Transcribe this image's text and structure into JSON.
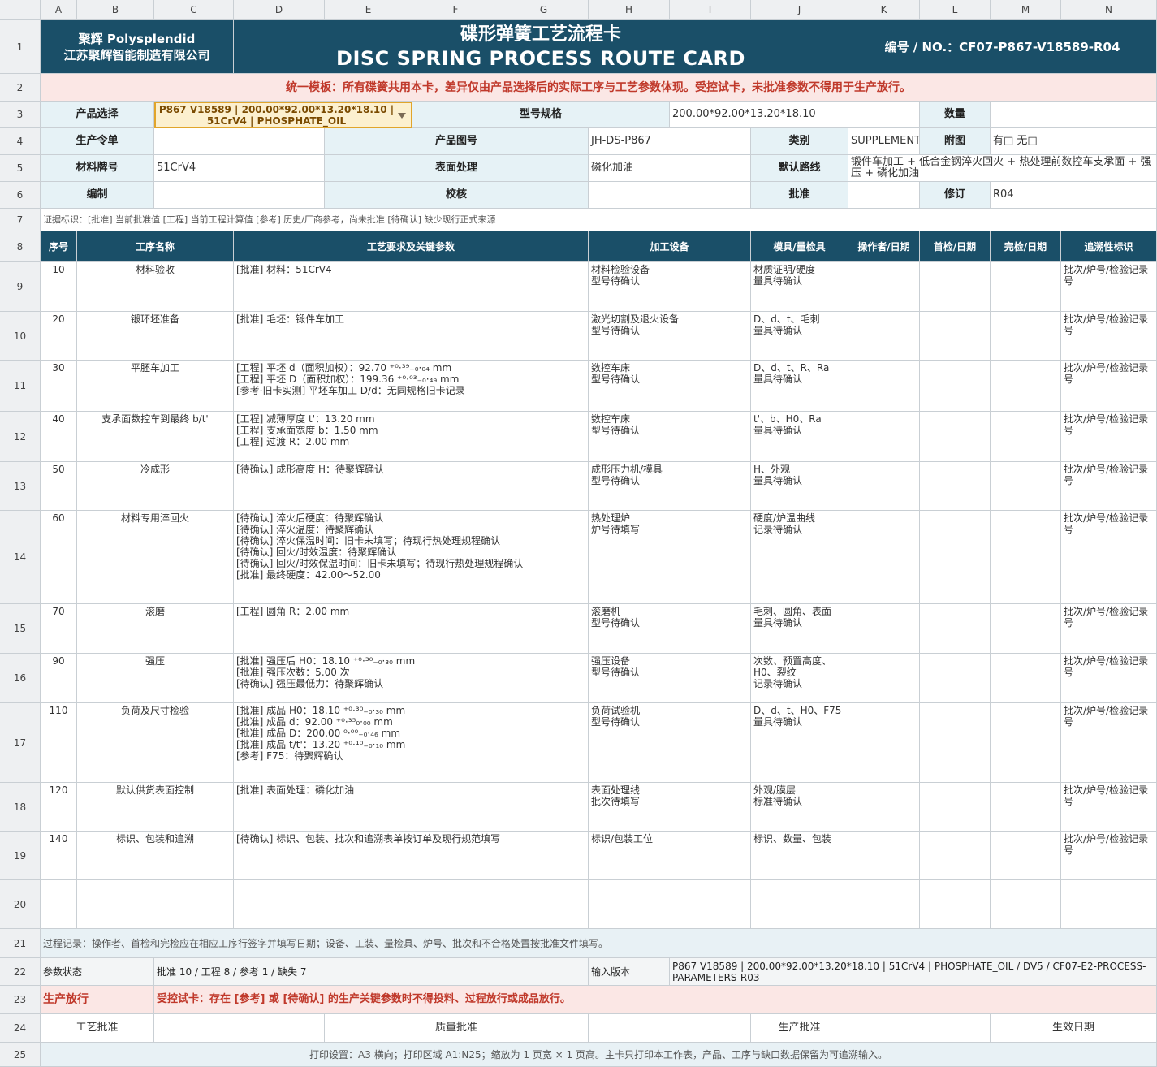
{
  "columns": [
    "A",
    "B",
    "C",
    "D",
    "E",
    "F",
    "G",
    "H",
    "I",
    "J",
    "K",
    "L",
    "M",
    "N"
  ],
  "rows": [
    "1",
    "2",
    "3",
    "4",
    "5",
    "6",
    "7",
    "8",
    "9",
    "10",
    "11",
    "12",
    "13",
    "14",
    "15",
    "16",
    "17",
    "18",
    "19",
    "20",
    "21",
    "22",
    "23",
    "24",
    "25"
  ],
  "header": {
    "company_en": "聚辉 Polysplendid",
    "company_cn": "江苏聚辉智能制造有限公司",
    "title_cn": "碟形弹簧工艺流程卡",
    "title_en": "DISC SPRING PROCESS ROUTE CARD",
    "number": "编号 / NO.：CF07-P867-V18589-R04"
  },
  "notice": "统一模板：所有碟簧共用本卡，差异仅由产品选择后的实际工序与工艺参数体现。受控试卡，未批准参数不得用于生产放行。",
  "info": {
    "product_select_label": "产品选择",
    "product_select_value": "P867 V18589 | 200.00*92.00*13.20*18.10 | 51CrV4 | PHOSPHATE_OIL",
    "model_spec_label": "型号规格",
    "model_spec_value": "200.00*92.00*13.20*18.10",
    "quantity_label": "数量",
    "quantity_value": "",
    "order_label": "生产令单",
    "order_value": "",
    "drawing_label": "产品图号",
    "drawing_value": "JH-DS-P867",
    "category_label": "类别",
    "category_value": "SUPPLEMENTARY",
    "attachment_label": "附图",
    "attachment_value": "有□  无□",
    "material_label": "材料牌号",
    "material_value": "51CrV4",
    "surface_label": "表面处理",
    "surface_value": "磷化加油",
    "route_label": "默认路线",
    "route_value": "锻件车加工 + 低合金钢淬火回火 + 热处理前数控车支承面 + 强压 + 磷化加油",
    "compile_label": "编制",
    "compile_value": "",
    "check_label": "校核",
    "check_value": "",
    "approve_label": "批准",
    "approve_value": "",
    "revision_label": "修订",
    "revision_value": "R04"
  },
  "evidence_note": "证据标识：[批准] 当前批准值   [工程] 当前工程计算值   [参考] 历史/厂商参考，尚未批准   [待确认] 缺少现行正式来源",
  "table_headers": {
    "seq": "序号",
    "name": "工序名称",
    "req": "工艺要求及关键参数",
    "equip": "加工设备",
    "tool": "模具/量检具",
    "operator": "操作者/日期",
    "first": "首检/日期",
    "final": "完检/日期",
    "trace": "追溯性标识"
  },
  "steps": [
    {
      "seq": "10",
      "name": "材料验收",
      "req": "[批准] 材料：51CrV4",
      "equip": "材料检验设备\n型号待确认",
      "tool": "材质证明/硬度\n量具待确认",
      "trace": "批次/炉号/检验记录号"
    },
    {
      "seq": "20",
      "name": "锻环坯准备",
      "req": "[批准] 毛坯：锻件车加工",
      "equip": "激光切割及退火设备\n型号待确认",
      "tool": "D、d、t、毛刺\n量具待确认",
      "trace": "批次/炉号/检验记录号"
    },
    {
      "seq": "30",
      "name": "平胚车加工",
      "req": "[工程] 平坯 d（面积加权）：92.70 ⁺⁰·³⁹₋₀·₀₄ mm\n[工程] 平坯 D（面积加权）：199.36 ⁺⁰·⁰³₋₀·₄₉ mm\n[参考·旧卡实测] 平坯车加工 D/d：无同规格旧卡记录",
      "equip": "数控车床\n型号待确认",
      "tool": "D、d、t、R、Ra\n量具待确认",
      "trace": "批次/炉号/检验记录号"
    },
    {
      "seq": "40",
      "name": "支承面数控车到最终 b/t'",
      "req": "[工程] 减薄厚度 t'：13.20 mm\n[工程] 支承面宽度 b：1.50 mm\n[工程] 过渡 R：2.00 mm",
      "equip": "数控车床\n型号待确认",
      "tool": "t'、b、H0、Ra\n量具待确认",
      "trace": "批次/炉号/检验记录号"
    },
    {
      "seq": "50",
      "name": "冷成形",
      "req": "[待确认] 成形高度 H：待聚辉确认",
      "equip": "成形压力机/模具\n型号待确认",
      "tool": "H、外观\n量具待确认",
      "trace": "批次/炉号/检验记录号"
    },
    {
      "seq": "60",
      "name": "材料专用淬回火",
      "req": "[待确认] 淬火后硬度：待聚辉确认\n[待确认] 淬火温度：待聚辉确认\n[待确认] 淬火保温时间：旧卡未填写；待现行热处理规程确认\n[待确认] 回火/时效温度：待聚辉确认\n[待确认] 回火/时效保温时间：旧卡未填写；待现行热处理规程确认\n[批准] 最终硬度：42.00～52.00",
      "equip": "热处理炉\n炉号待填写",
      "tool": "硬度/炉温曲线\n记录待确认",
      "trace": "批次/炉号/检验记录号"
    },
    {
      "seq": "70",
      "name": "滚磨",
      "req": "[工程] 圆角 R：2.00 mm",
      "equip": "滚磨机\n型号待确认",
      "tool": "毛刺、圆角、表面\n量具待确认",
      "trace": "批次/炉号/检验记录号"
    },
    {
      "seq": "90",
      "name": "强压",
      "req": "[批准] 强压后 H0：18.10 ⁺⁰·³⁰₋₀·₃₀ mm\n[批准] 强压次数：5.00 次\n[待确认] 强压最低力：待聚辉确认",
      "equip": "强压设备\n型号待确认",
      "tool": "次数、预置高度、H0、裂纹\n记录待确认",
      "trace": "批次/炉号/检验记录号"
    },
    {
      "seq": "110",
      "name": "负荷及尺寸检验",
      "req": "[批准] 成品 H0：18.10 ⁺⁰·³⁰₋₀·₃₀ mm\n[批准] 成品 d：92.00 ⁺⁰·³⁵₀·₀₀ mm\n[批准] 成品 D：200.00 ⁰·⁰⁰₋₀·₄₆ mm\n[批准] 成品 t/t'：13.20 ⁺⁰·¹⁰₋₀·₁₀ mm\n[参考] F75：待聚辉确认",
      "equip": "负荷试验机\n型号待确认",
      "tool": "D、d、t、H0、F75\n量具待确认",
      "trace": "批次/炉号/检验记录号"
    },
    {
      "seq": "120",
      "name": "默认供货表面控制",
      "req": "[批准] 表面处理：磷化加油",
      "equip": "表面处理线\n批次待填写",
      "tool": "外观/膜层\n标准待确认",
      "trace": "批次/炉号/检验记录号"
    },
    {
      "seq": "140",
      "name": "标识、包装和追溯",
      "req": "[待确认] 标识、包装、批次和追溯表单按订单及现行规范填写",
      "equip": "标识/包装工位",
      "tool": "标识、数量、包装",
      "trace": "批次/炉号/检验记录号"
    }
  ],
  "process_record": "过程记录：操作者、首检和完检应在相应工序行签字并填写日期；设备、工装、量检具、炉号、批次和不合格处置按批准文件填写。",
  "param_status_label": "参数状态",
  "param_status_value": "批准 10 / 工程 8 / 参考 1 / 缺失 7",
  "input_version_label": "输入版本",
  "input_version_value": "P867 V18589 | 200.00*92.00*13.20*18.10 | 51CrV4 | PHOSPHATE_OIL / DV5 / CF07-E2-PROCESS-PARAMETERS-R03",
  "release_label": "生产放行",
  "release_value": "受控试卡：存在 [参考] 或 [待确认] 的生产关键参数时不得投料、过程放行或成品放行。",
  "signoff": {
    "process_approval": "工艺批准",
    "quality_approval": "质量批准",
    "production_approval": "生产批准",
    "effective_date": "生效日期"
  },
  "print_settings": "打印设置：A3 横向；打印区域 A1:N25；缩放为 1 页宽 × 1 页高。主卡只打印本工作表，产品、工序与缺口数据保留为可追溯输入。",
  "colors": {
    "teal": "#1a4f68",
    "label_bg": "#e6f2f6",
    "warning_bg": "#fbe7e5",
    "warning_text": "#c0392b",
    "select_bg": "#fcf0cf",
    "select_border": "#e1a52b"
  }
}
